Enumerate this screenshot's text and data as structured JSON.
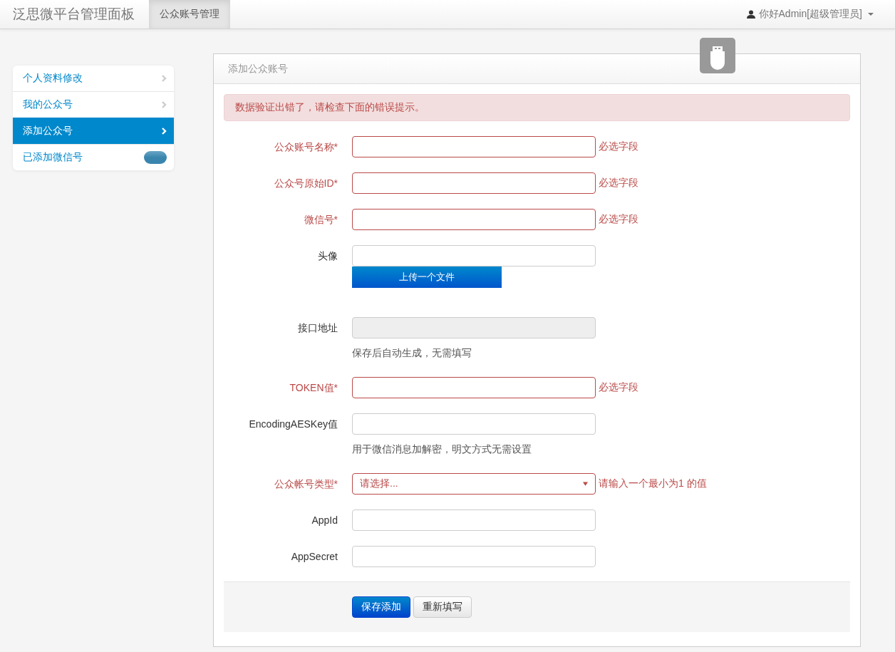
{
  "navbar": {
    "brand": "泛思微平台管理面板",
    "tabs": [
      {
        "label": "公众账号管理",
        "selected": true
      }
    ],
    "user": "你好Admin[超级管理员]"
  },
  "sidebar": {
    "items": [
      {
        "label": "个人资料修改",
        "selected": false,
        "kind": "link"
      },
      {
        "label": "我的公众号",
        "selected": false,
        "kind": "link"
      },
      {
        "label": "添加公众号",
        "selected": true,
        "kind": "link"
      },
      {
        "label": "已添加微信号",
        "selected": false,
        "kind": "badge"
      }
    ]
  },
  "panel": {
    "title": "添加公众账号",
    "alert": "数据验证出错了，请检查下面的错误提示。",
    "fields": [
      {
        "label": "公众账号名称*",
        "kind": "text",
        "invalid": true,
        "message": "必选字段"
      },
      {
        "label": "公众号原始ID*",
        "kind": "text",
        "invalid": true,
        "message": "必选字段"
      },
      {
        "label": "微信号*",
        "kind": "text",
        "invalid": true,
        "message": "必选字段"
      },
      {
        "label": "头像",
        "kind": "file",
        "invalid": false,
        "button": "上传一个文件"
      },
      {
        "label": "接口地址",
        "kind": "text",
        "disabled": true,
        "invalid": false,
        "help": "保存后自动生成，无需填写"
      },
      {
        "label": "TOKEN值*",
        "kind": "text",
        "invalid": true,
        "message": "必选字段"
      },
      {
        "label": "EncodingAESKey值",
        "kind": "text",
        "invalid": false,
        "help": "用于微信消息加解密，明文方式无需设置"
      },
      {
        "label": "公众帐号类型*",
        "kind": "select",
        "invalid": true,
        "value": "请选择...",
        "message": "请输入一个最小为1 的值"
      },
      {
        "label": "AppId",
        "kind": "text",
        "invalid": false
      },
      {
        "label": "AppSecret",
        "kind": "text",
        "invalid": false
      }
    ],
    "buttons": [
      {
        "label": "保存添加",
        "kind": "primary"
      },
      {
        "label": "重新填写",
        "kind": "default"
      }
    ]
  }
}
